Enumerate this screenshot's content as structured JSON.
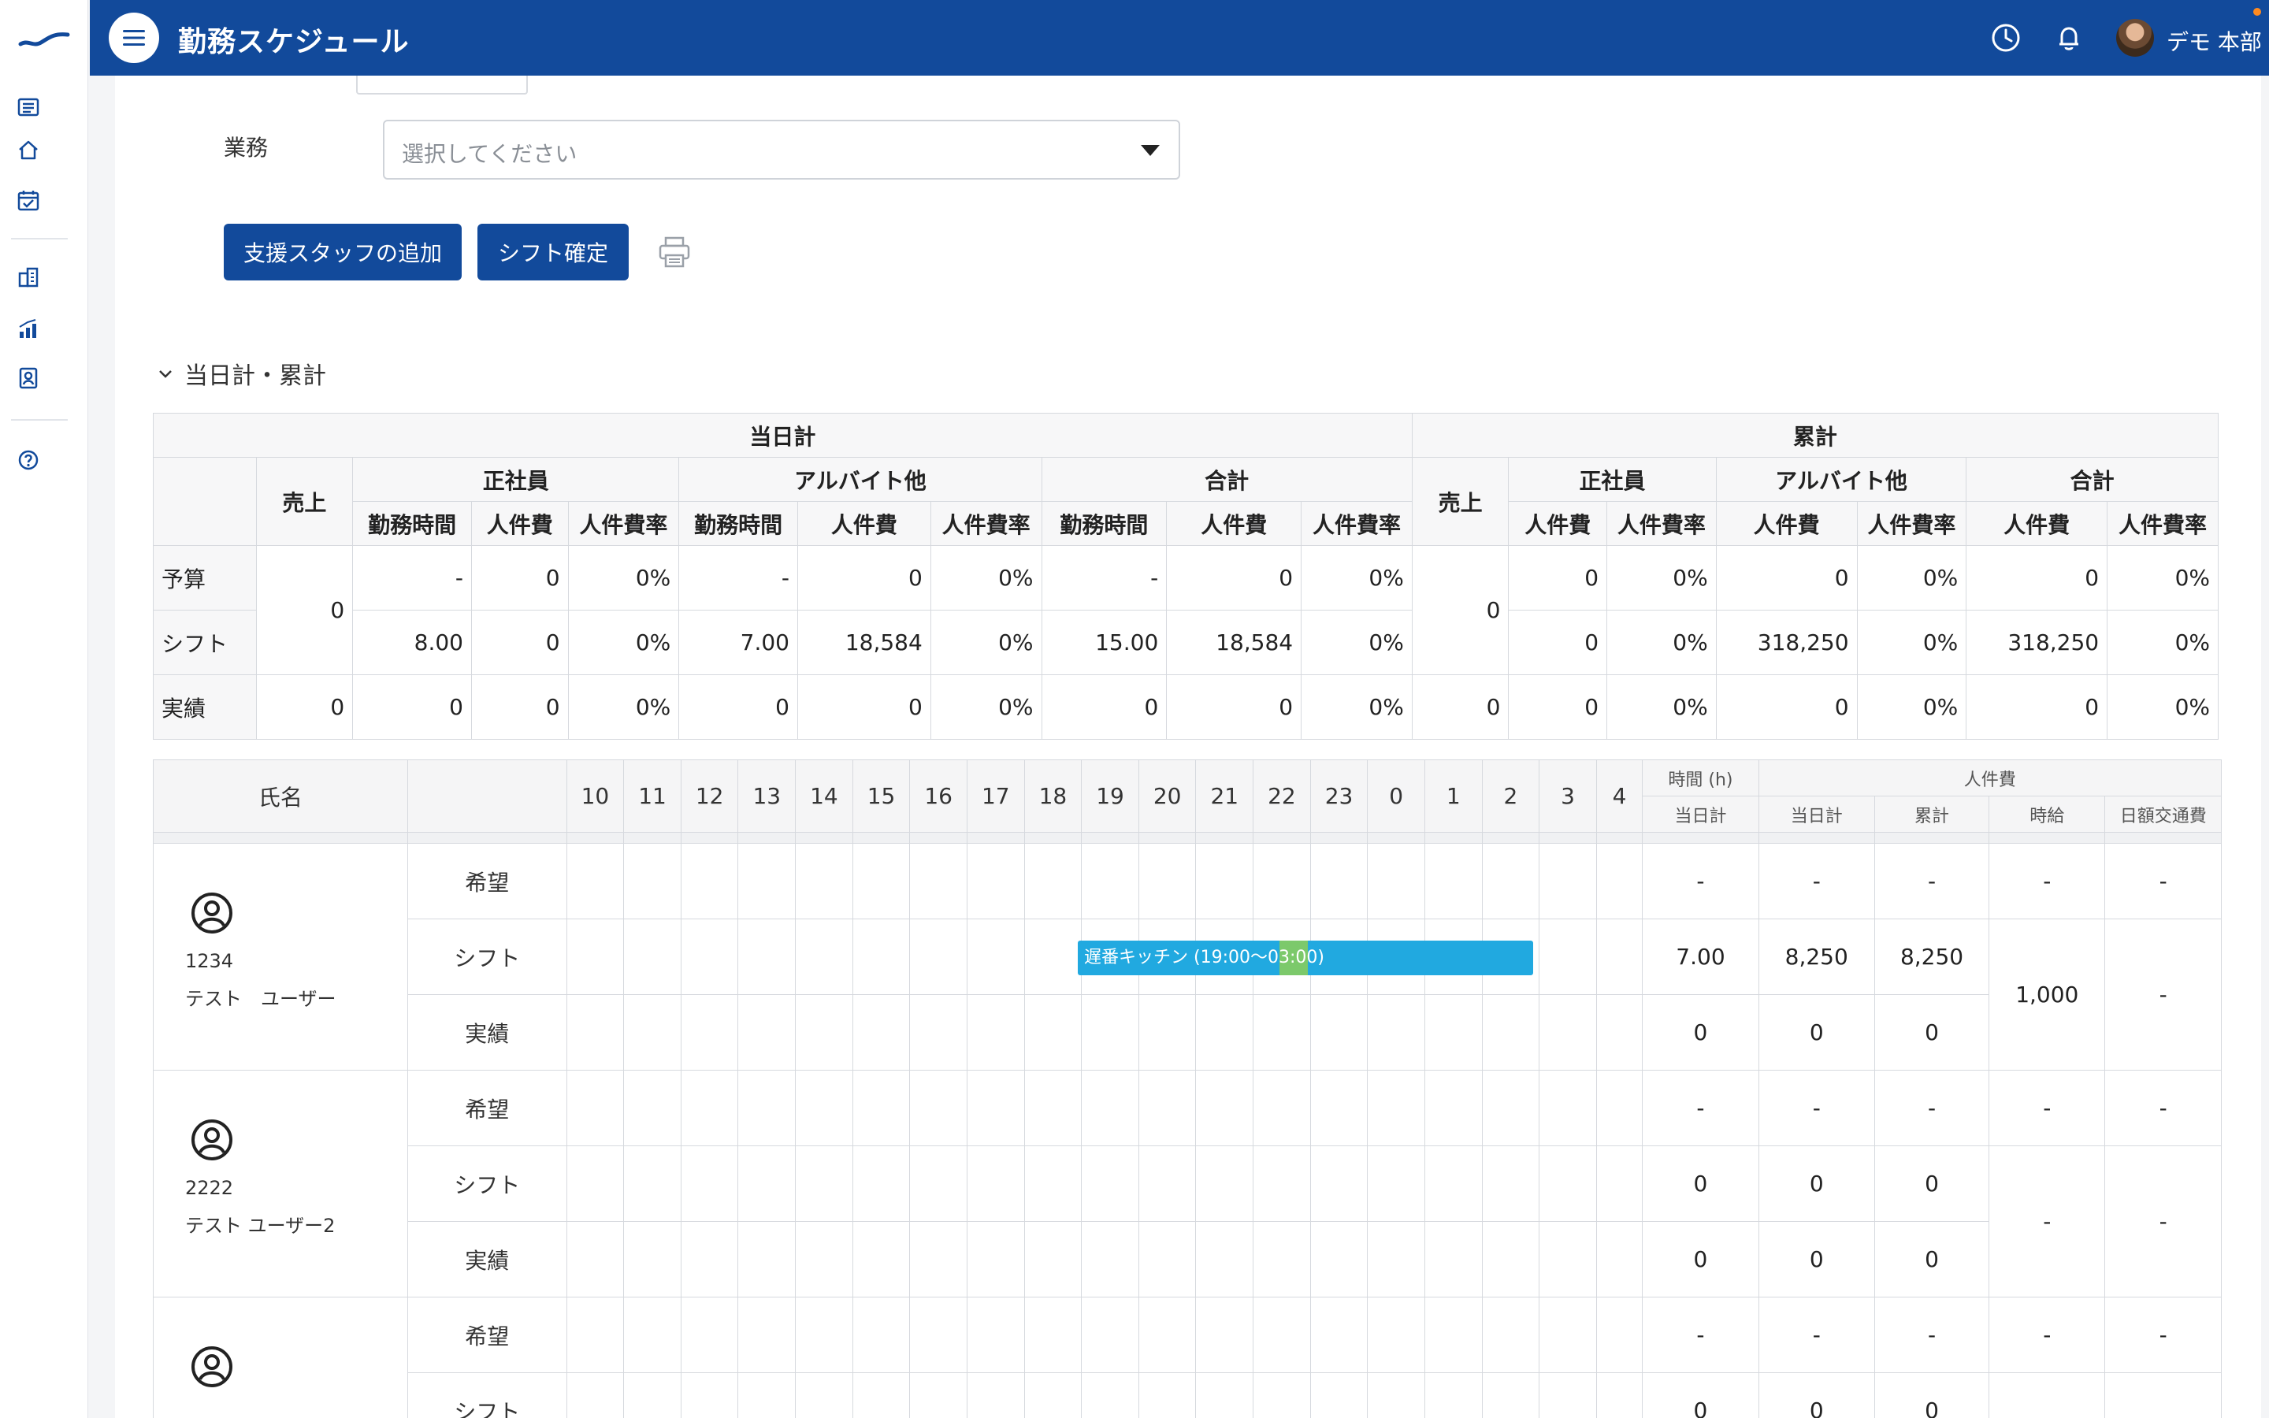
{
  "header": {
    "title": "勤務スケジュール",
    "username": "デモ 本部"
  },
  "form": {
    "gyomu_label": "業務",
    "gyomu_placeholder": "選択してください",
    "add_staff_button": "支援スタッフの追加",
    "confirm_button": "シフト確定"
  },
  "section": {
    "title": "当日計・累計"
  },
  "summary": {
    "group_today": "当日計",
    "group_cumulative": "累計",
    "col_sales": "売上",
    "col_seishain": "正社員",
    "col_arbeit": "アルバイト他",
    "col_total": "合計",
    "sub_hours": "勤務時間",
    "sub_cost": "人件費",
    "sub_rate": "人件費率",
    "rows": [
      {
        "label": "予算",
        "sales": "0",
        "s_hours": "-",
        "s_cost": "0",
        "s_rate": "0%",
        "a_hours": "-",
        "a_cost": "0",
        "a_rate": "0%",
        "t_hours": "-",
        "t_cost": "0",
        "t_rate": "0%",
        "c_sales": "0",
        "c_s_cost": "0",
        "c_s_rate": "0%",
        "c_a_cost": "0",
        "c_a_rate": "0%",
        "c_t_cost": "0",
        "c_t_rate": "0%"
      },
      {
        "label": "シフト",
        "s_hours": "8.00",
        "s_cost": "0",
        "s_rate": "0%",
        "a_hours": "7.00",
        "a_cost": "18,584",
        "a_rate": "0%",
        "t_hours": "15.00",
        "t_cost": "18,584",
        "t_rate": "0%",
        "c_s_cost": "0",
        "c_s_rate": "0%",
        "c_a_cost": "318,250",
        "c_a_rate": "0%",
        "c_t_cost": "318,250",
        "c_t_rate": "0%"
      },
      {
        "label": "実績",
        "sales": "0",
        "s_hours": "0",
        "s_cost": "0",
        "s_rate": "0%",
        "a_hours": "0",
        "a_cost": "0",
        "a_rate": "0%",
        "t_hours": "0",
        "t_cost": "0",
        "t_rate": "0%",
        "c_sales": "0",
        "c_s_cost": "0",
        "c_s_rate": "0%",
        "c_a_cost": "0",
        "c_a_rate": "0%",
        "c_t_cost": "0",
        "c_t_rate": "0%"
      }
    ]
  },
  "schedule": {
    "col_name": "氏名",
    "hours": [
      "10",
      "11",
      "12",
      "13",
      "14",
      "15",
      "16",
      "17",
      "18",
      "19",
      "20",
      "21",
      "22",
      "23",
      "0",
      "1",
      "2",
      "3",
      "4"
    ],
    "col_time": "時間 (h)",
    "col_labor": "人件費",
    "sub_today_time": "当日計",
    "sub_today_cost": "当日計",
    "sub_cumulative": "累計",
    "sub_hourly": "時給",
    "sub_transport": "日額交通費",
    "row_types": {
      "hope": "希望",
      "shift": "シフト",
      "actual": "実績"
    },
    "employees": [
      {
        "id": "1234",
        "name": "テスト　ユーザー",
        "hope": {
          "time": "-",
          "today": "-",
          "cum": "-",
          "hourly": "-",
          "transport": "-"
        },
        "shift": {
          "time": "7.00",
          "today": "8,250",
          "cum": "8,250"
        },
        "actual": {
          "time": "0",
          "today": "0",
          "cum": "0"
        },
        "hourly": "1,000",
        "transport": "-",
        "shift_bar": "遅番キッチン (19:00～03:00)"
      },
      {
        "id": "2222",
        "name": "テスト ユーザー2",
        "hope": {
          "time": "-",
          "today": "-",
          "cum": "-",
          "hourly": "-",
          "transport": "-"
        },
        "shift": {
          "time": "0",
          "today": "0",
          "cum": "0"
        },
        "actual": {
          "time": "0",
          "today": "0",
          "cum": "0"
        },
        "hourly": "-",
        "transport": "-"
      },
      {
        "hope": {
          "time": "-",
          "today": "-",
          "cum": "-",
          "hourly": "-",
          "transport": "-"
        },
        "shift": {
          "time": "0",
          "today": "0",
          "cum": "0"
        }
      }
    ]
  },
  "colors": {
    "header_bg": "#124a9b",
    "shift_bar": "#21a9e0",
    "shift_bar_accent": "#7cc96b"
  }
}
